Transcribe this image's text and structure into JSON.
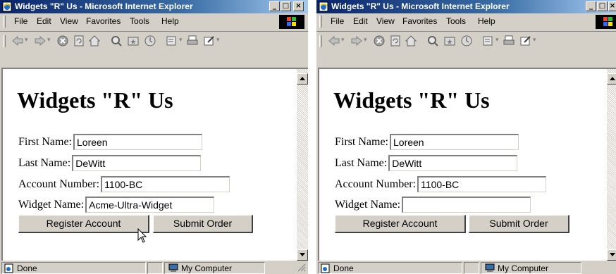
{
  "windows": [
    {
      "title": "Widgets \"R\" Us - Microsoft Internet Explorer",
      "menu": [
        "File",
        "Edit",
        "View",
        "Favorites",
        "Tools",
        "Help"
      ],
      "heading": "Widgets \"R\" Us",
      "fields": [
        {
          "label": "First Name:",
          "value": "Loreen"
        },
        {
          "label": "Last Name:",
          "value": "DeWitt"
        },
        {
          "label": "Account Number:",
          "value": "1100-BC"
        },
        {
          "label": "Widget Name:",
          "value": "Acme-Ultra-Widget"
        }
      ],
      "buttons": {
        "register": "Register Account",
        "submit": "Submit Order"
      },
      "status": {
        "text": "Done",
        "zone": "My Computer"
      }
    },
    {
      "title": "Widgets \"R\" Us - Microsoft Internet Explorer",
      "menu": [
        "File",
        "Edit",
        "View",
        "Favorites",
        "Tools",
        "Help"
      ],
      "heading": "Widgets \"R\" Us",
      "fields": [
        {
          "label": "First Name:",
          "value": "Loreen"
        },
        {
          "label": "Last Name:",
          "value": "DeWitt"
        },
        {
          "label": "Account Number:",
          "value": "1100-BC"
        },
        {
          "label": "Widget Name:",
          "value": ""
        }
      ],
      "buttons": {
        "register": "Register Account",
        "submit": "Submit Order"
      },
      "status": {
        "text": "Done",
        "zone": "My Computer"
      }
    }
  ],
  "icons": {
    "app": "ie-page-icon",
    "title_controls": [
      "minimize-icon",
      "maximize-icon",
      "close-icon"
    ],
    "toolbar": [
      "back-icon",
      "forward-icon",
      "stop-icon",
      "refresh-icon",
      "home-icon",
      "search-icon",
      "favorites-icon",
      "history-icon",
      "mail-icon",
      "print-icon",
      "edit-icon"
    ],
    "status": [
      "page-done-icon",
      "computer-icon"
    ]
  },
  "colors": {
    "title_start": "#0a246a",
    "title_end": "#a6caf0",
    "chrome": "#d4d0c8"
  }
}
